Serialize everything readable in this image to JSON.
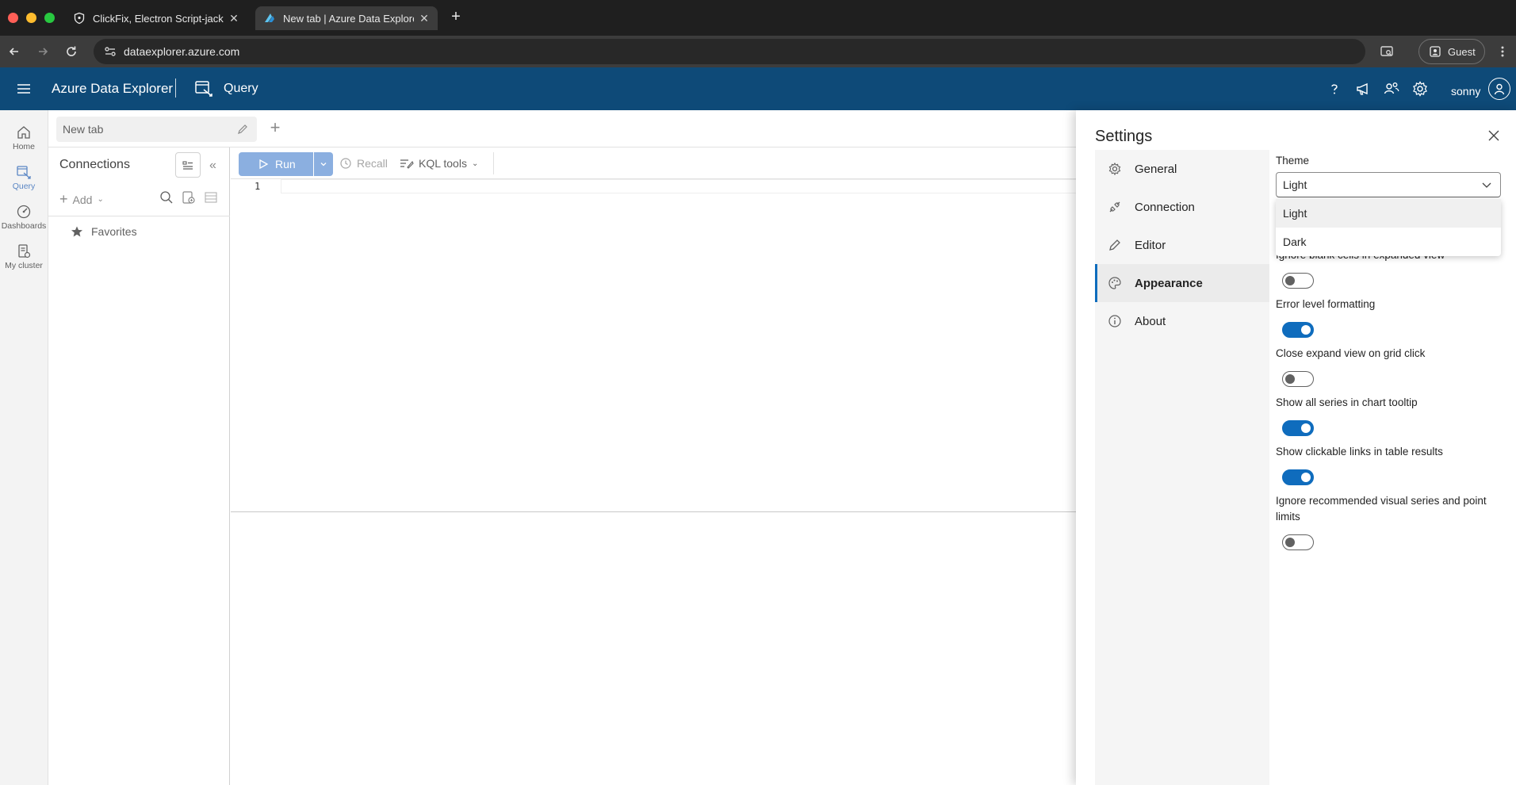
{
  "browser": {
    "tabs": [
      {
        "title": "ClickFix, Electron Script-jacki",
        "active": false
      },
      {
        "title": "New tab | Azure Data Explorer",
        "active": true
      }
    ],
    "url": "dataexplorer.azure.com",
    "profile": "Guest"
  },
  "header": {
    "app_name": "Azure Data Explorer",
    "section": "Query",
    "user": "sonny"
  },
  "rail": {
    "items": [
      {
        "label": "Home",
        "icon": "home-icon"
      },
      {
        "label": "Query",
        "icon": "query-icon",
        "active": true
      },
      {
        "label": "Dashboards",
        "icon": "dashboards-icon"
      },
      {
        "label": "My cluster",
        "icon": "my-cluster-icon"
      }
    ]
  },
  "doc": {
    "tab_title": "New tab"
  },
  "connections": {
    "title": "Connections",
    "add_label": "Add",
    "favorites": "Favorites"
  },
  "query_toolbar": {
    "run": "Run",
    "recall": "Recall",
    "kql_tools": "KQL tools"
  },
  "editor": {
    "line_number": "1"
  },
  "settings": {
    "title": "Settings",
    "nav": [
      {
        "label": "General",
        "icon": "gear-icon"
      },
      {
        "label": "Connection",
        "icon": "plug-icon"
      },
      {
        "label": "Editor",
        "icon": "pencil-icon"
      },
      {
        "label": "Appearance",
        "icon": "palette-icon",
        "active": true
      },
      {
        "label": "About",
        "icon": "info-icon"
      }
    ],
    "theme_label": "Theme",
    "theme_value": "Light",
    "theme_options": [
      "Light",
      "Dark"
    ],
    "options": [
      {
        "label": "Ignore blank cells in expanded view",
        "enabled": false
      },
      {
        "label": "Error level formatting",
        "enabled": true
      },
      {
        "label": "Close expand view on grid click",
        "enabled": false
      },
      {
        "label": "Show all series in chart tooltip",
        "enabled": true
      },
      {
        "label": "Show clickable links in table results",
        "enabled": true
      },
      {
        "label": "Ignore recommended visual series and point limits",
        "enabled": false
      }
    ],
    "accent_color": "#0f6cbd"
  }
}
